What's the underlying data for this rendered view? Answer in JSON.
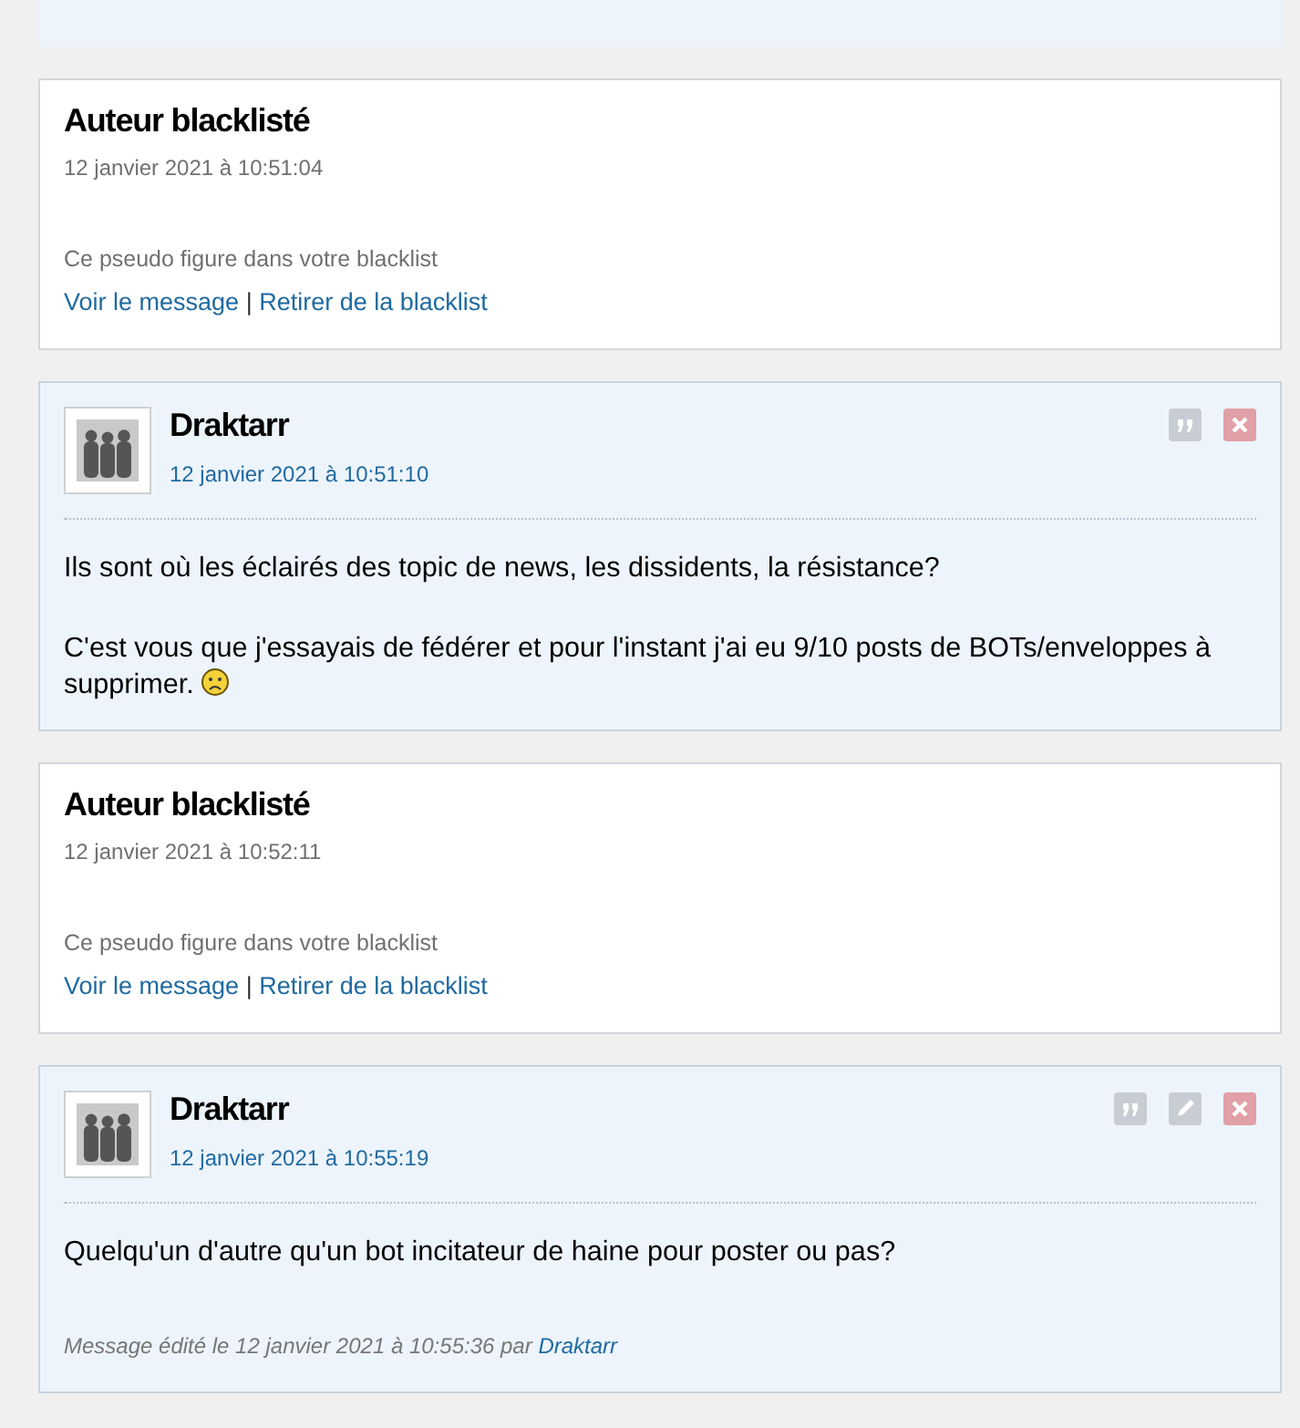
{
  "posts": [
    {
      "kind": "cut"
    },
    {
      "kind": "blacklisted",
      "title": "Auteur blacklisté",
      "date": "12 janvier 2021 à 10:51:04",
      "notice": "Ce pseudo figure dans votre blacklist",
      "view_link": "Voir le message",
      "separator": "|",
      "remove_link": "Retirer de la blacklist"
    },
    {
      "kind": "message",
      "author": "Draktarr",
      "date": "12 janvier 2021 à 10:51:10",
      "actions": [
        {
          "kind": "quote"
        },
        {
          "kind": "delete"
        }
      ],
      "paragraphs": [
        {
          "lines": [
            "Ils sont où les éclairés des topic de news, les dissidents, la résistance?"
          ],
          "smiley": false
        },
        {
          "lines": [
            "C'est vous que j'essayais de fédérer et pour l'instant j'ai eu 9/10 posts de BOTs/enveloppes à",
            "supprimer."
          ],
          "smiley": true
        }
      ]
    },
    {
      "kind": "blacklisted",
      "title": "Auteur blacklisté",
      "date": "12 janvier 2021 à 10:52:11",
      "notice": "Ce pseudo figure dans votre blacklist",
      "view_link": "Voir le message",
      "separator": "|",
      "remove_link": "Retirer de la blacklist"
    },
    {
      "kind": "message",
      "author": "Draktarr",
      "date": "12 janvier 2021 à 10:55:19",
      "actions": [
        {
          "kind": "quote"
        },
        {
          "kind": "edit"
        },
        {
          "kind": "delete"
        }
      ],
      "paragraphs": [
        {
          "lines": [
            "Quelqu'un d'autre qu'un bot incitateur de haine pour poster ou pas?"
          ],
          "smiley": false
        }
      ],
      "edit_note": {
        "text": "Message édité le 12 janvier 2021 à 10:55:36 par ",
        "author": "Draktarr"
      }
    }
  ]
}
